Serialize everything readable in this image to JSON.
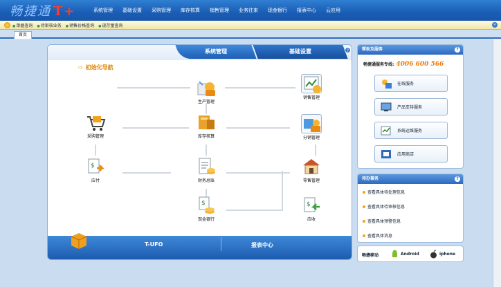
{
  "app": {
    "logo_text": "畅捷通",
    "logo_mark": "T+"
  },
  "main_menu": [
    "系统管理",
    "基础设置",
    "采购管理",
    "库存核算",
    "销售管理",
    "业务往来",
    "现金银行",
    "报表中心",
    "云应用"
  ],
  "quick_links": [
    "单据查询",
    "待审核业务",
    "销售价格查询",
    "现存量查询"
  ],
  "tabs": [
    {
      "label": "首页",
      "active": true
    }
  ],
  "main_panel": {
    "header_tabs": [
      "系统管理",
      "基础设置"
    ],
    "guide_title": "初始化导航",
    "nodes": {
      "production": "生产管理",
      "sales": "销售管理",
      "purchase": "采购管理",
      "inventory": "库存核算",
      "distribution": "分销管理",
      "payable": "应付",
      "finance": "财务总账",
      "store": "零售管理",
      "cash_bank": "现金银行",
      "receivable": "应收"
    },
    "footer": {
      "left_label": "T-UFO",
      "right_label": "报表中心"
    }
  },
  "help_panel": {
    "title": "帮助及服务",
    "hotline_label": "畅捷通服务专线:",
    "hotline_number": "4006 600 566",
    "buttons": [
      "在线服务",
      "产品支持服务",
      "系统运维服务",
      "应用商店"
    ]
  },
  "tasks_panel": {
    "title": "待办事务",
    "items": [
      "查看具体待处理信息",
      "查看具体待审核信息",
      "查看具体预警信息",
      "查看具体消息"
    ]
  },
  "mobile": {
    "label": "畅捷移动",
    "android": "Android",
    "iphone": "iphone"
  },
  "colors": {
    "header_blue": "#1a5db5",
    "accent_orange": "#f07b00",
    "panel_border": "#8bb2de"
  }
}
